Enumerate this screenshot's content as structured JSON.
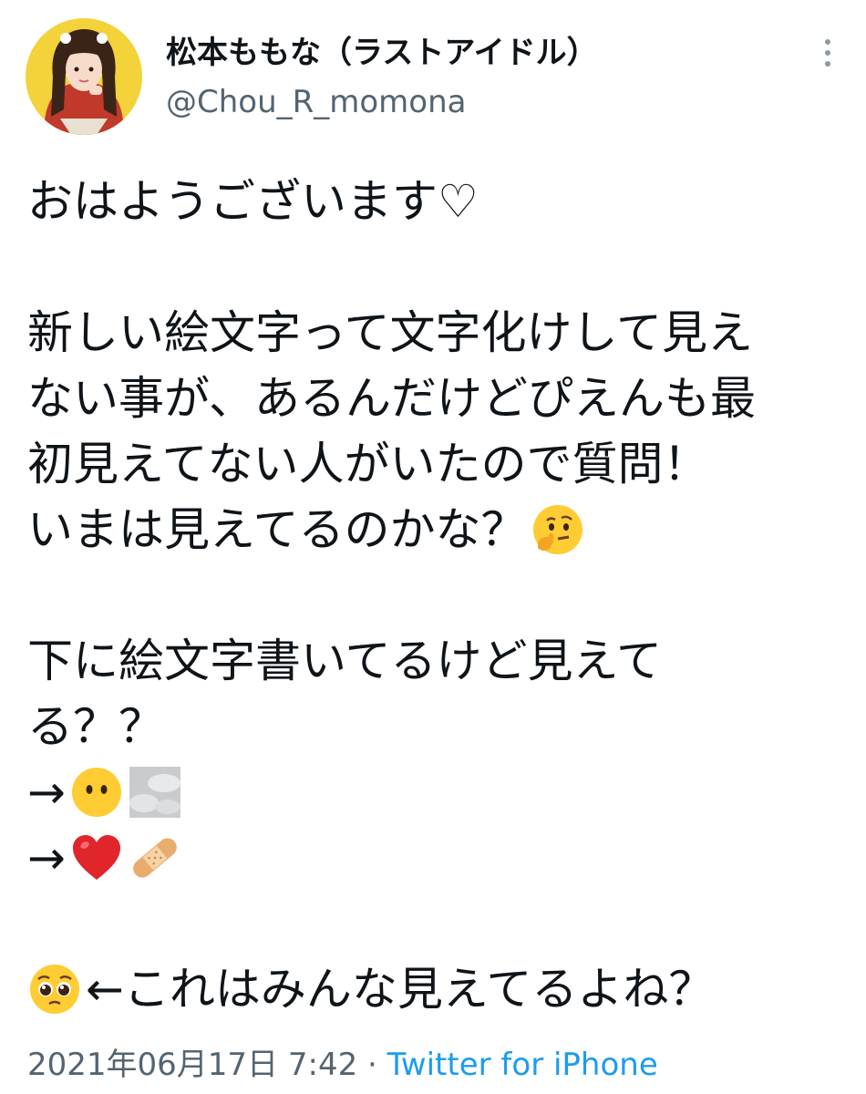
{
  "author": {
    "display_name": "松本ももな（ラストアイドル）",
    "handle": "@Chou_R_momona"
  },
  "tweet": {
    "line_1": "おはようございます♡",
    "line_2": "新しい絵文字って文字化けして見え",
    "line_3": "ない事が、あるんだけどぴえんも最",
    "line_4": "初見えてない人がいたので質問！",
    "line_5": "いまは見えてるのかな？",
    "line_6": "下に絵文字書いてるけど見えて",
    "line_7": "る？？",
    "line_8": "→",
    "line_9": "→",
    "line_10": "←これはみんな見えてるよね？",
    "emoji": {
      "thinking": "thinking-face",
      "no_mouth": "face-without-mouth",
      "clouds": "face-in-clouds",
      "heart": "red-heart",
      "bandage": "adhesive-bandage",
      "pleading": "pleading-face"
    }
  },
  "footer": {
    "timestamp": "2021年06月17日 7:42",
    "separator": "·",
    "source": "Twitter for iPhone"
  },
  "colors": {
    "text": "#0f1419",
    "secondary": "#536471",
    "link": "#1d9bf0",
    "avatar_bg": "#f3d23a"
  }
}
